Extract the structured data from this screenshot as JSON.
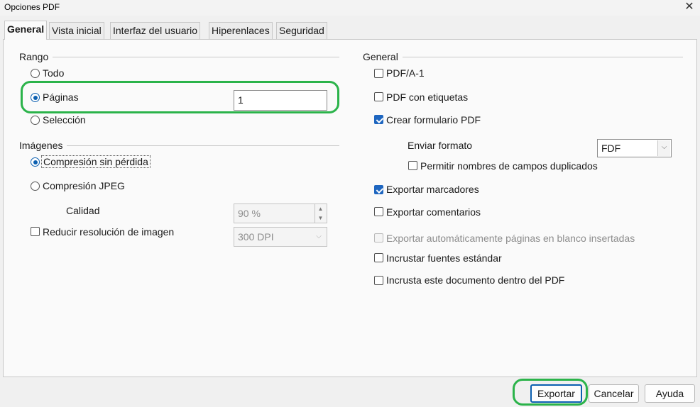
{
  "window": {
    "title": "Opciones PDF",
    "close_glyph": "✕"
  },
  "tabs": [
    "General",
    "Vista inicial",
    "Interfaz del usuario",
    "Hiperenlaces",
    "Seguridad"
  ],
  "rango": {
    "title": "Rango",
    "todo": "Todo",
    "paginas": "Páginas",
    "paginas_value": "1",
    "seleccion": "Selección"
  },
  "imagenes": {
    "title": "Imágenes",
    "compresion_sin_perdida": "Compresión sin pérdida",
    "compresion_jpeg": "Compresión JPEG",
    "calidad_label": "Calidad",
    "calidad_value": "90 %",
    "reducir_resolucion": "Reducir resolución de imagen",
    "resolucion_value": "300 DPI"
  },
  "general": {
    "title": "General",
    "pdfa1": "PDF/A-1",
    "pdf_etiquetas": "PDF con etiquetas",
    "crear_formulario": "Crear formulario PDF",
    "enviar_formato_label": "Enviar formato",
    "enviar_formato_value": "FDF",
    "permitir_nombres": "Permitir nombres de campos duplicados",
    "exportar_marcadores": "Exportar marcadores",
    "exportar_comentarios": "Exportar comentarios",
    "exportar_paginas_blanco": "Exportar automáticamente páginas en blanco insertadas",
    "incrustar_fuentes": "Incrustar fuentes estándar",
    "incrusta_documento": "Incrusta este documento dentro del PDF"
  },
  "buttons": {
    "exportar": "Exportar",
    "cancelar": "Cancelar",
    "ayuda": "Ayuda"
  },
  "state": {
    "rango_selected": "Páginas",
    "compresion_selected": "Compresión sin pérdida",
    "checked": [
      "Crear formulario PDF",
      "Exportar marcadores"
    ],
    "disabled": [
      "Exportar automáticamente páginas en blanco insertadas",
      "Calidad",
      "Reducir resolución de imagen value"
    ]
  },
  "colors": {
    "accent": "#1e66c0",
    "highlight": "#2bb34a"
  }
}
